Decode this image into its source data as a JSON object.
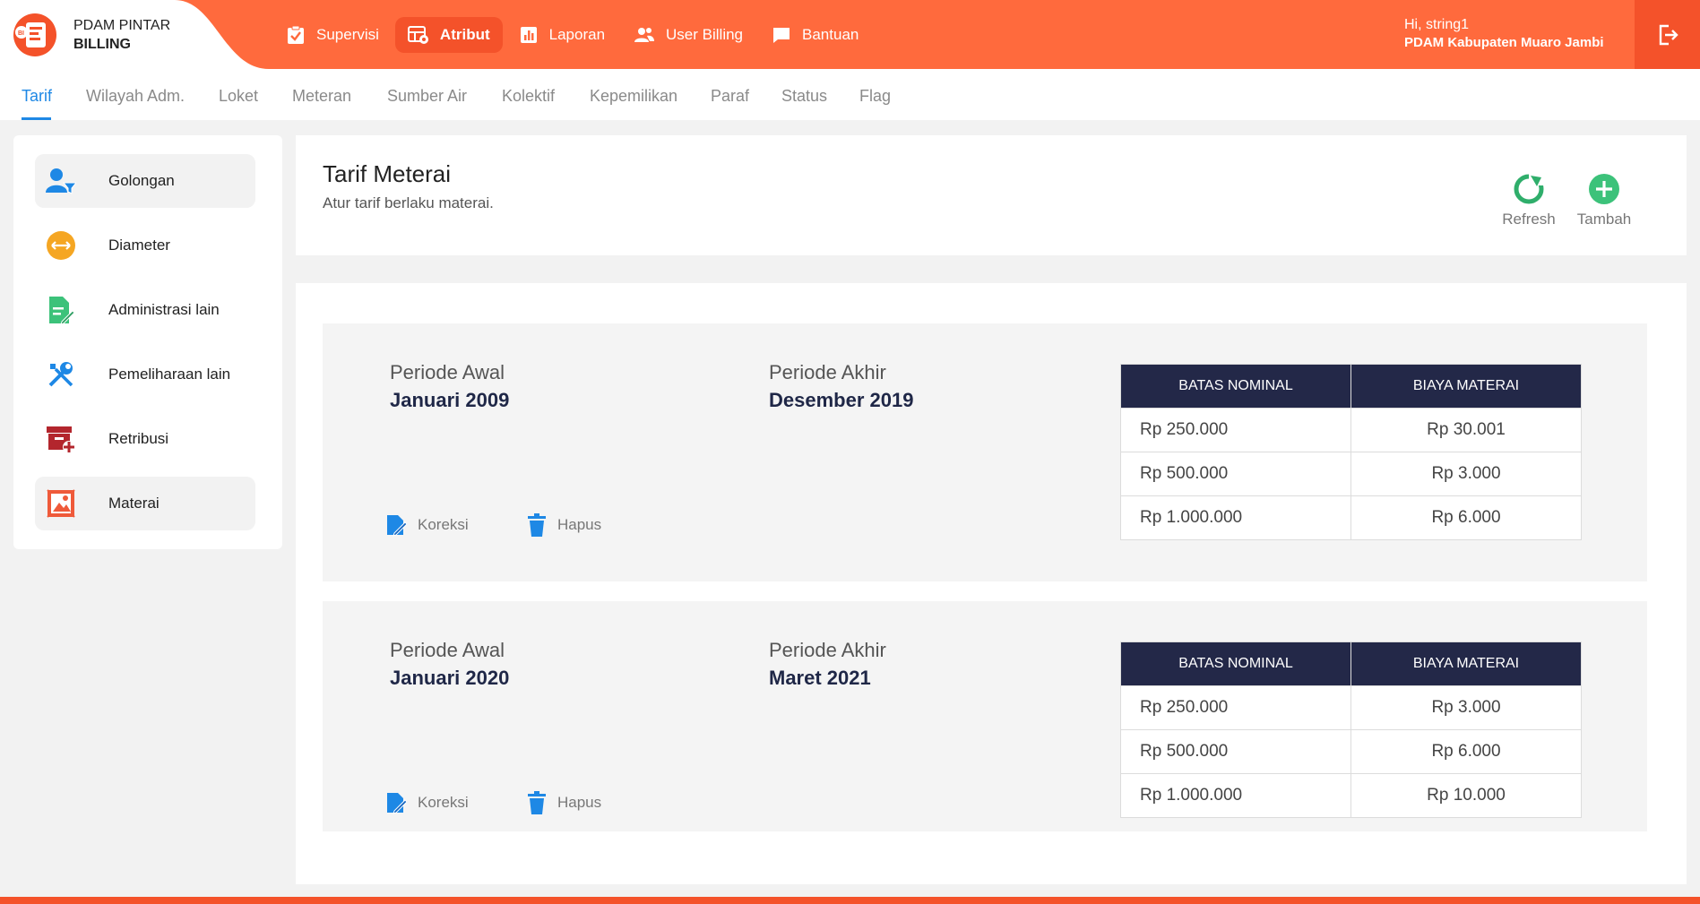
{
  "brand": {
    "line1": "PDAM PINTAR",
    "line2": "BILLING"
  },
  "nav": [
    {
      "label": "Supervisi",
      "icon": "clipboard-check-icon"
    },
    {
      "label": "Atribut",
      "icon": "grid-settings-icon",
      "active": true
    },
    {
      "label": "Laporan",
      "icon": "bar-chart-icon"
    },
    {
      "label": "User Billing",
      "icon": "users-icon"
    },
    {
      "label": "Bantuan",
      "icon": "chat-bubble-icon"
    }
  ],
  "user": {
    "greeting": "Hi, string1",
    "org": "PDAM Kabupaten Muaro Jambi"
  },
  "subtabs": [
    "Tarif",
    "Wilayah Adm.",
    "Loket",
    "Meteran",
    "Sumber Air",
    "Kolektif",
    "Kepemilikan",
    "Paraf",
    "Status",
    "Flag"
  ],
  "sidebar": {
    "items": [
      {
        "label": "Golongan",
        "icon": "user-filter-icon"
      },
      {
        "label": "Diameter",
        "icon": "diameter-icon"
      },
      {
        "label": "Administrasi lain",
        "icon": "document-edit-icon"
      },
      {
        "label": "Pemeliharaan lain",
        "icon": "tools-icon"
      },
      {
        "label": "Retribusi",
        "icon": "archive-plus-icon"
      },
      {
        "label": "Materai",
        "icon": "stamp-icon"
      }
    ]
  },
  "header": {
    "title": "Tarif Meterai",
    "subtitle": "Atur tarif berlaku materai.",
    "refresh_label": "Refresh",
    "add_label": "Tambah"
  },
  "colors": {
    "primary": "#ff6a3d",
    "primary_dark": "#f4522a",
    "accent": "#1e88e5",
    "table_header": "#232848"
  },
  "periods": [
    {
      "start_label": "Periode Awal",
      "start": "Januari 2009",
      "end_label": "Periode Akhir",
      "end": "Desember 2019",
      "edit_label": "Koreksi",
      "delete_label": "Hapus",
      "table": {
        "headers": [
          "BATAS NOMINAL",
          "BIAYA MATERAI"
        ],
        "rows": [
          [
            "Rp 250.000",
            "Rp 30.001"
          ],
          [
            "Rp 500.000",
            "Rp 3.000"
          ],
          [
            "Rp 1.000.000",
            "Rp 6.000"
          ]
        ]
      }
    },
    {
      "start_label": "Periode Awal",
      "start": "Januari 2020",
      "end_label": "Periode Akhir",
      "end": "Maret 2021",
      "edit_label": "Koreksi",
      "delete_label": "Hapus",
      "table": {
        "headers": [
          "BATAS NOMINAL",
          "BIAYA MATERAI"
        ],
        "rows": [
          [
            "Rp 250.000",
            "Rp 3.000"
          ],
          [
            "Rp 500.000",
            "Rp 6.000"
          ],
          [
            "Rp 1.000.000",
            "Rp 10.000"
          ]
        ]
      }
    }
  ]
}
